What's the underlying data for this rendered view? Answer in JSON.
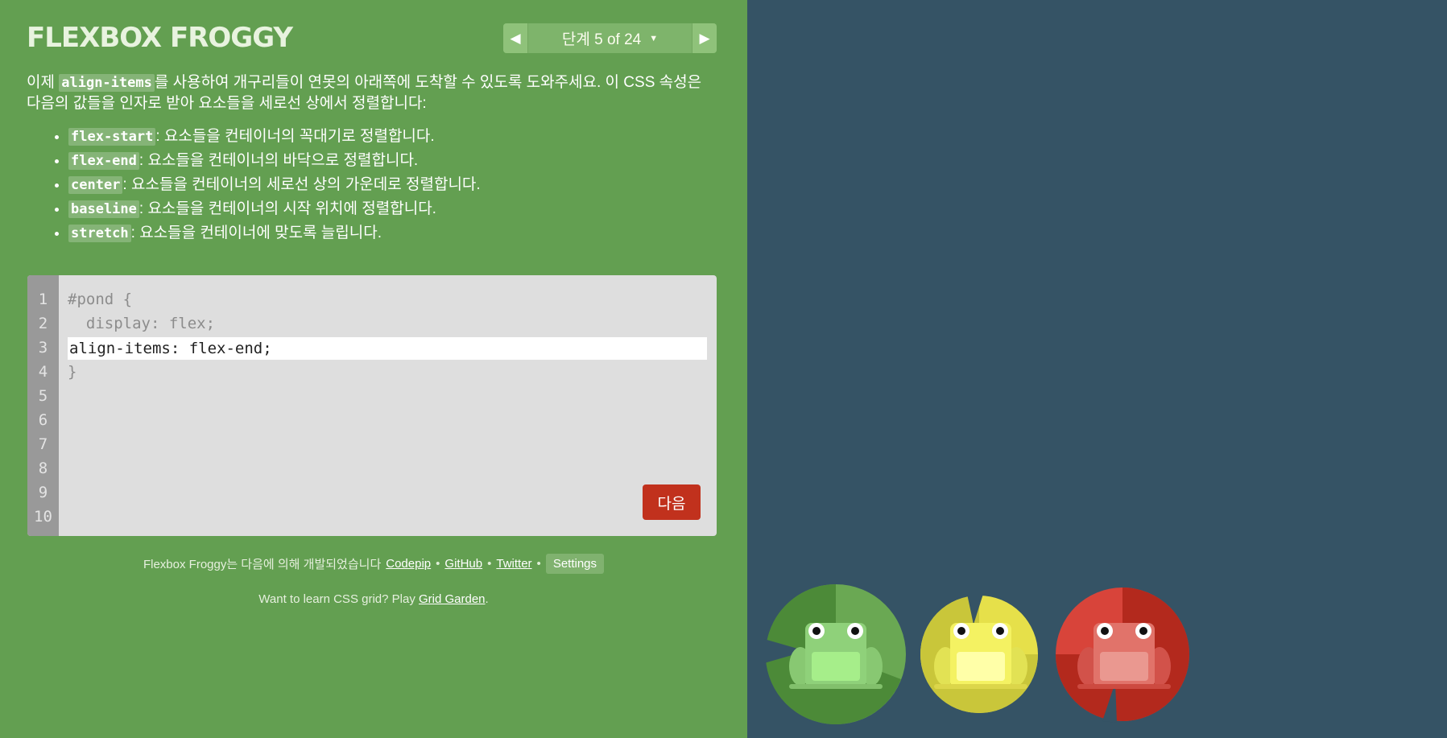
{
  "header": {
    "logo": "FLEXBOX FROGGY",
    "level_indicator": "단계 5 of 24",
    "prev_icon": "triangle-left-icon",
    "next_icon": "triangle-right-icon",
    "dropdown_icon": "caret-down-icon"
  },
  "instructions": {
    "intro_prefix": "이제 ",
    "intro_code": "align-items",
    "intro_suffix": "를 사용하여 개구리들이 연못의 아래쪽에 도착할 수 있도록 도와주세요. 이 CSS 속성은 다음의 값들을 인자로 받아 요소들을 세로선 상에서 정렬합니다:",
    "items": [
      {
        "code": "flex-start",
        "text": ": 요소들을 컨테이너의 꼭대기로 정렬합니다."
      },
      {
        "code": "flex-end",
        "text": ": 요소들을 컨테이너의 바닥으로 정렬합니다."
      },
      {
        "code": "center",
        "text": ": 요소들을 컨테이너의 세로선 상의 가운데로 정렬합니다."
      },
      {
        "code": "baseline",
        "text": ": 요소들을 컨테이너의 시작 위치에 정렬합니다."
      },
      {
        "code": "stretch",
        "text": ": 요소들을 컨테이너에 맞도록 늘립니다."
      }
    ]
  },
  "editor": {
    "line_numbers": [
      "1",
      "2",
      "3",
      "4",
      "5",
      "6",
      "7",
      "8",
      "9",
      "10"
    ],
    "line1": "#pond {",
    "line2": "  display: flex;",
    "input_value": "align-items: flex-end;",
    "line4": "}",
    "next_button": "다음"
  },
  "footer": {
    "credits_text": "Flexbox Froggy는 다음에 의해 개발되었습니다",
    "links": [
      "Codepip",
      "GitHub",
      "Twitter"
    ],
    "separator": "•",
    "settings_label": "Settings",
    "grid_prefix": "Want to learn CSS grid? Play ",
    "grid_link": "Grid Garden",
    "grid_suffix": "."
  },
  "colors": {
    "sidebar": "#639f51",
    "pond": "#355365",
    "next_button": "#c1311d",
    "green_pad": "#4c8a38",
    "yellow_pad": "#c9c63a",
    "red_pad": "#b3291d"
  },
  "pond": {
    "frogs": [
      "green-frog-icon",
      "yellow-frog-icon",
      "red-frog-icon"
    ],
    "lilypads": [
      "green-lilypad-icon",
      "yellow-lilypad-icon",
      "red-lilypad-icon"
    ]
  }
}
